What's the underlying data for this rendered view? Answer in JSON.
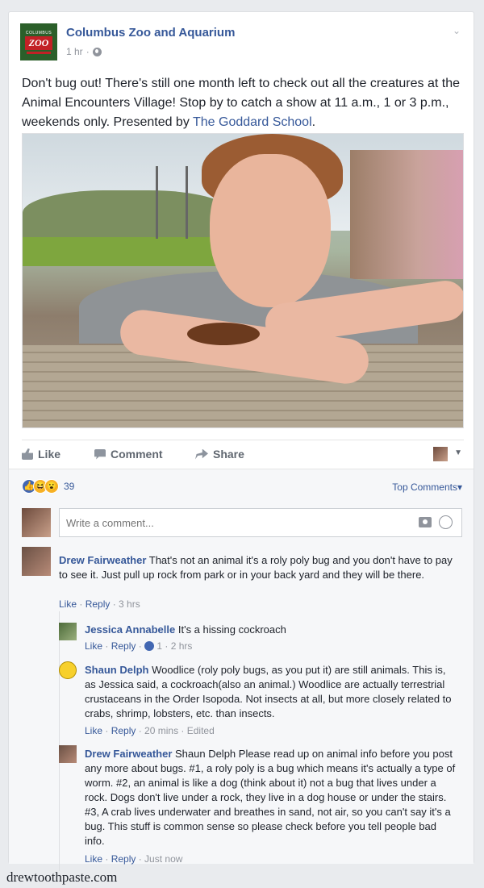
{
  "post": {
    "page_name": "Columbus Zoo and Aquarium",
    "time": "1 hr",
    "logo_top": "COLUMBUS",
    "logo_main": "ZOO",
    "text_part1": "Don't bug out! There's still one month left to check out all the creatures at the Animal Encounters Village! Stop by to catch a show at 11 a.m., 1 or 3 p.m., weekends only. Presented by ",
    "text_mention": "The Goddard School",
    "text_part2": "."
  },
  "actions": {
    "like": "Like",
    "comment": "Comment",
    "share": "Share"
  },
  "reactions": {
    "count": "39",
    "sort_label": "Top Comments",
    "caret": "▾"
  },
  "composer": {
    "placeholder": "Write a comment..."
  },
  "comments": [
    {
      "author": "Drew Fairweather",
      "text": " That's not an animal it's a roly poly bug and you don't have to pay to see it. Just pull up rock from park or in your back yard and they will be there.",
      "like": "Like",
      "reply": "Reply",
      "time": "3 hrs"
    },
    {
      "author": "Jessica Annabelle",
      "text": " It's a hissing cockroach",
      "like": "Like",
      "reply": "Reply",
      "likes": "1",
      "time": "2 hrs"
    },
    {
      "author": "Shaun Delph",
      "text": " Woodlice (roly poly bugs, as you put it) are still animals. This is, as Jessica said, a cockroach(also an animal.) Woodlice are actually terrestrial crustaceans in the Order Isopoda. Not insects at all, but more closely related to crabs, shrimp, lobsters, etc. than insects.",
      "like": "Like",
      "reply": "Reply",
      "time": "20 mins",
      "edited": "Edited"
    },
    {
      "author": "Drew Fairweather",
      "text": " Shaun Delph Please read up on animal info before you post any more about bugs. #1, a roly poly is a bug which means it's actually a type of worm. #2, an animal is like a dog (think about it) not a bug that lives under a rock. Dogs don't live under a rock, they live in a dog house or under the stairs. #3, A crab lives underwater and breathes in sand, not air, so you can't say it's a bug. This stuff is common sense so please check before you tell people bad info.",
      "like": "Like",
      "reply": "Reply",
      "time": "Just now"
    }
  ],
  "footer": {
    "watermark": "drewtoothpaste.com"
  },
  "colors": {
    "link": "#365899",
    "meta": "#90949c",
    "like_blue": "#4267b2"
  }
}
